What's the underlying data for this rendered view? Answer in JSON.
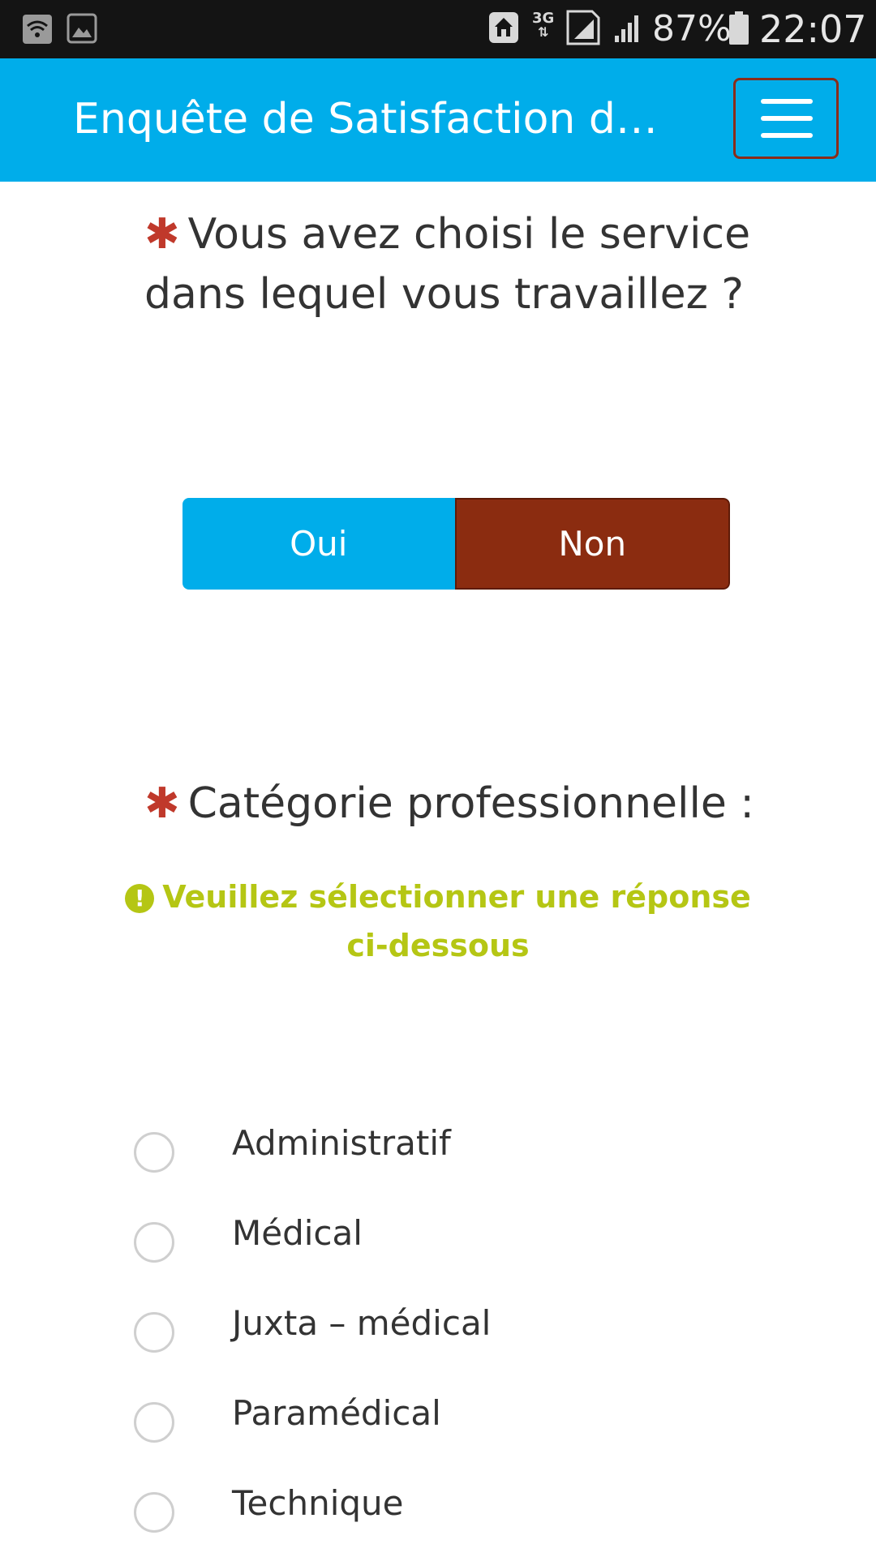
{
  "status_bar": {
    "network": "3G",
    "network_arrows": "⇅",
    "battery": "87%",
    "time": "22:07",
    "icons": [
      "wifi-icon",
      "image-icon",
      "home-icon",
      "sim-signal-icon",
      "signal-icon",
      "battery-icon"
    ]
  },
  "header": {
    "title": "Enquête de Satisfaction du Personnel",
    "menu_icon": "hamburger-menu-icon",
    "background": "#00adea"
  },
  "question1": {
    "required_mark": "✱",
    "text": "Vous avez choisi le service dans lequel vous travaillez ?",
    "options": [
      "Oui",
      "Non"
    ],
    "selected": "Non",
    "colors": {
      "oui": "#00adea",
      "non": "#8b2c10"
    }
  },
  "question2": {
    "required_mark": "✱",
    "text": "Catégorie professionnelle :",
    "warning_icon": "!",
    "warning": "Veuillez sélectionner une réponse ci-dessous",
    "warning_color": "#b5c614",
    "options": [
      "Administratif",
      "Médical",
      "Juxta – médical",
      "Paramédical",
      "Technique"
    ]
  }
}
